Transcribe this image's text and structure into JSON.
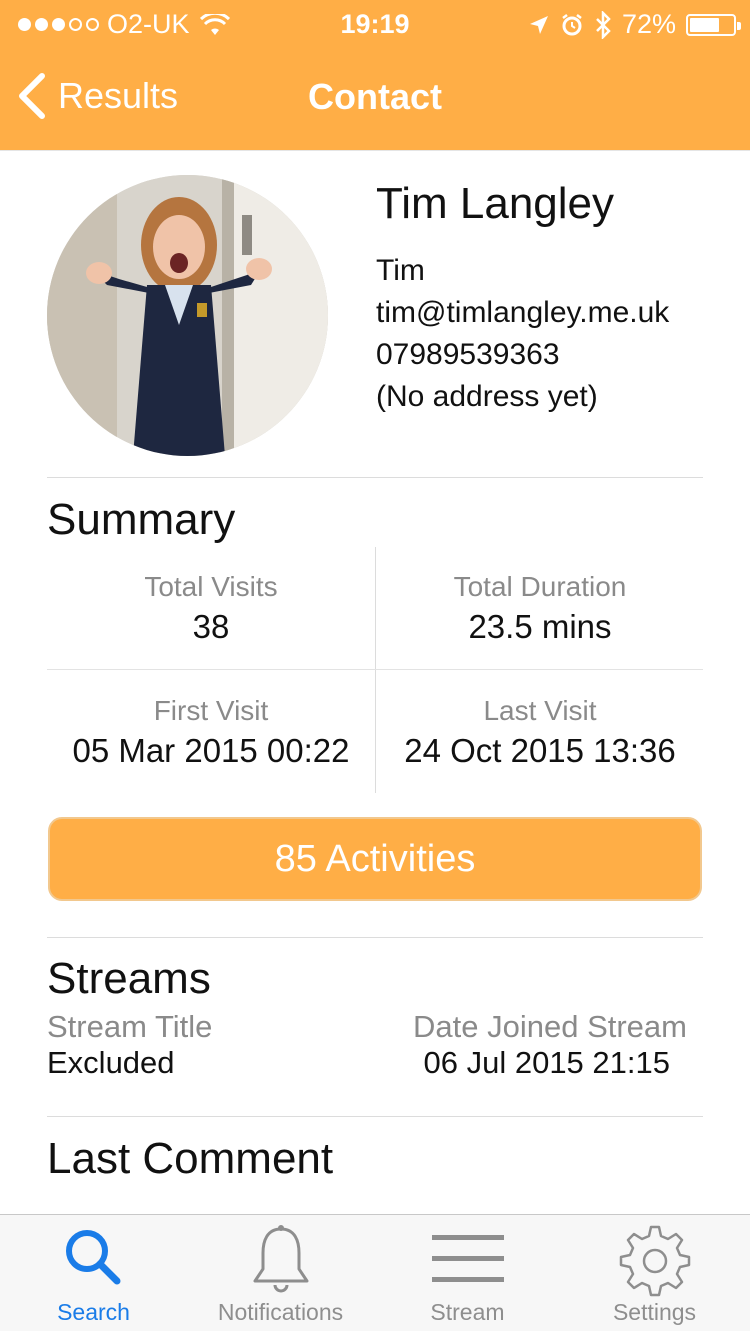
{
  "status_bar": {
    "carrier": "O2-UK",
    "time": "19:19",
    "battery": "72%",
    "battery_level": 0.72,
    "signal_bars_filled": 3,
    "signal_bars_total": 5
  },
  "nav": {
    "back_label": "Results",
    "title": "Contact"
  },
  "contact": {
    "name": "Tim Langley",
    "first_name": "Tim",
    "email": "tim@timlangley.me.uk",
    "phone": "07989539363",
    "address": "(No address yet)"
  },
  "summary": {
    "title": "Summary",
    "total_visits_label": "Total Visits",
    "total_visits_value": "38",
    "total_duration_label": "Total Duration",
    "total_duration_value": "23.5 mins",
    "first_visit_label": "First Visit",
    "first_visit_value": "05 Mar 2015 00:22",
    "last_visit_label": "Last Visit",
    "last_visit_value": "24 Oct 2015 13:36"
  },
  "activities_button": "85 Activities",
  "streams": {
    "title": "Streams",
    "col_title_label": "Stream Title",
    "col_date_label": "Date Joined Stream",
    "rows": [
      {
        "title": "Excluded",
        "date": "06 Jul 2015 21:15"
      }
    ]
  },
  "last_comment": {
    "title": "Last Comment"
  },
  "tabbar": {
    "tabs": [
      {
        "label": "Search",
        "icon": "search-icon",
        "active": true
      },
      {
        "label": "Notifications",
        "icon": "bell-icon",
        "active": false
      },
      {
        "label": "Stream",
        "icon": "menu-lines-icon",
        "active": false
      },
      {
        "label": "Settings",
        "icon": "gear-icon",
        "active": false
      }
    ]
  },
  "colors": {
    "accent": "#FFAE46",
    "active_tab": "#1a7ce8",
    "secondary_text": "#8a8a8a"
  }
}
